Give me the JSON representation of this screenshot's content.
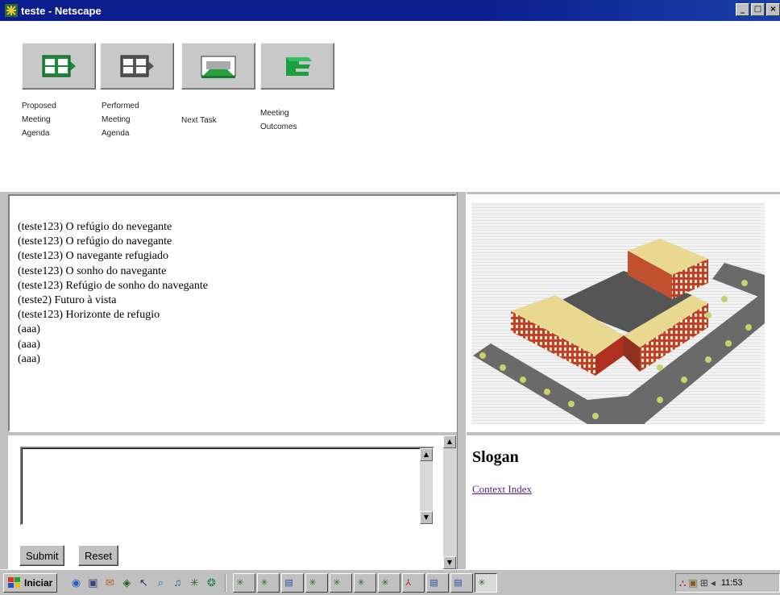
{
  "window": {
    "title": "teste - Netscape",
    "controls": [
      "_",
      "□",
      "×"
    ]
  },
  "toolbar": {
    "items": [
      {
        "label": "Proposed\nMeeting\nAgenda",
        "icon": "book-arrow-icon"
      },
      {
        "label": "Performed\nMeeting\nAgenda",
        "icon": "book-arrow-icon"
      },
      {
        "label": "Next Task",
        "icon": "next-task-icon"
      },
      {
        "label": "Meeting\nOutcomes",
        "icon": "meeting-outcomes-icon"
      }
    ]
  },
  "chat": {
    "messages": [
      "(teste123) O refúgio do nevegante",
      "(teste123) O refúgio do navegante",
      "(teste123) O navegante refugiado",
      "(teste123) O sonho do navegante",
      "(teste123) Refúgio de sonho do navegante",
      "(teste2) Futuro à vista",
      "(teste123) Horizonte de refugio",
      "(aaa)",
      "(aaa)",
      "(aaa)"
    ]
  },
  "form": {
    "message_value": "",
    "submit_label": "Submit",
    "reset_label": "Reset"
  },
  "context": {
    "heading": "Slogan",
    "link_label": "Context Index"
  },
  "taskbar": {
    "start_label": "Iniciar",
    "clock": "11:53",
    "task_count": 13
  },
  "colors": {
    "titlebar": "#0a1d8c",
    "link": "#551a8b",
    "chrome": "#c0c0c0"
  }
}
